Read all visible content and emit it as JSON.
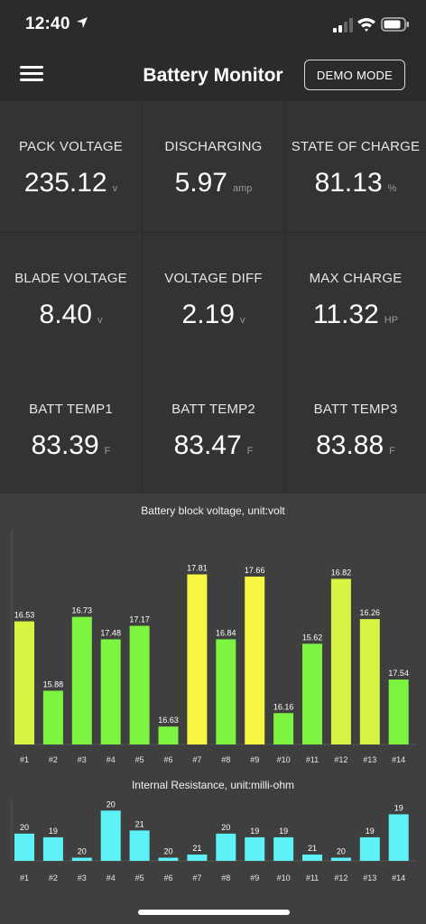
{
  "status": {
    "time": "12:40"
  },
  "header": {
    "title": "Battery Monitor",
    "demo_label": "DEMO MODE"
  },
  "metrics": [
    {
      "label": "PACK VOLTAGE",
      "value": "235.12",
      "unit": "v"
    },
    {
      "label": "DISCHARGING",
      "value": "5.97",
      "unit": "amp"
    },
    {
      "label": "STATE OF CHARGE",
      "value": "81.13",
      "unit": "%"
    },
    {
      "label": "BLADE VOLTAGE",
      "value": "8.40",
      "unit": "v"
    },
    {
      "label": "VOLTAGE DIFF",
      "value": "2.19",
      "unit": "v"
    },
    {
      "label": "MAX CHARGE",
      "value": "11.32",
      "unit": "HP"
    },
    {
      "label": "BATT TEMP1",
      "value": "83.39",
      "unit": "F"
    },
    {
      "label": "BATT TEMP2",
      "value": "83.47",
      "unit": "F"
    },
    {
      "label": "BATT TEMP3",
      "value": "83.88",
      "unit": "F"
    }
  ],
  "chart_data": [
    {
      "type": "bar",
      "title": "Battery block voltage, unit:volt",
      "categories": [
        "#1",
        "#2",
        "#3",
        "#4",
        "#5",
        "#6",
        "#7",
        "#8",
        "#9",
        "#10",
        "#11",
        "#12",
        "#13",
        "#14"
      ],
      "values": [
        16.53,
        15.88,
        16.73,
        17.48,
        17.17,
        16.63,
        17.81,
        16.84,
        17.66,
        16.16,
        15.62,
        16.82,
        16.26,
        17.54
      ],
      "value_labels": [
        "16.53",
        "15.88",
        "16.73",
        "17.48",
        "17.17",
        "16.63",
        "17.81",
        "16.84",
        "17.66",
        "16.16",
        "15.62",
        "16.82",
        "16.26",
        "17.54"
      ],
      "bar_heights": [
        0.55,
        0.24,
        0.57,
        0.47,
        0.53,
        0.08,
        0.76,
        0.47,
        0.75,
        0.14,
        0.45,
        0.74,
        0.56,
        0.29
      ],
      "colors": [
        "#d6f542",
        "#7cf542",
        "#7cf542",
        "#7cf542",
        "#7cf542",
        "#7cf542",
        "#f5f542",
        "#7cf542",
        "#f5f542",
        "#7cf542",
        "#7cf542",
        "#d6f542",
        "#d6f542",
        "#7cf542"
      ],
      "grid": false,
      "legend": "none"
    },
    {
      "type": "bar",
      "title": "Internal Resistance, unit:milli-ohm",
      "categories": [
        "#1",
        "#2",
        "#3",
        "#4",
        "#5",
        "#6",
        "#7",
        "#8",
        "#9",
        "#10",
        "#11",
        "#12",
        "#13",
        "#14"
      ],
      "values": [
        20,
        19,
        20,
        20,
        21,
        20,
        21,
        20,
        19,
        19,
        21,
        20,
        19,
        19
      ],
      "value_labels": [
        "20",
        "19",
        "20",
        "20",
        "21",
        "20",
        "21",
        "20",
        "19",
        "19",
        "21",
        "20",
        "19",
        "19"
      ],
      "bar_heights": [
        0.52,
        0.45,
        0.06,
        0.96,
        0.58,
        0.06,
        0.12,
        0.52,
        0.45,
        0.45,
        0.12,
        0.06,
        0.45,
        0.89
      ],
      "colors": [
        "#5cf2f7"
      ],
      "grid": false,
      "legend": "none"
    }
  ]
}
